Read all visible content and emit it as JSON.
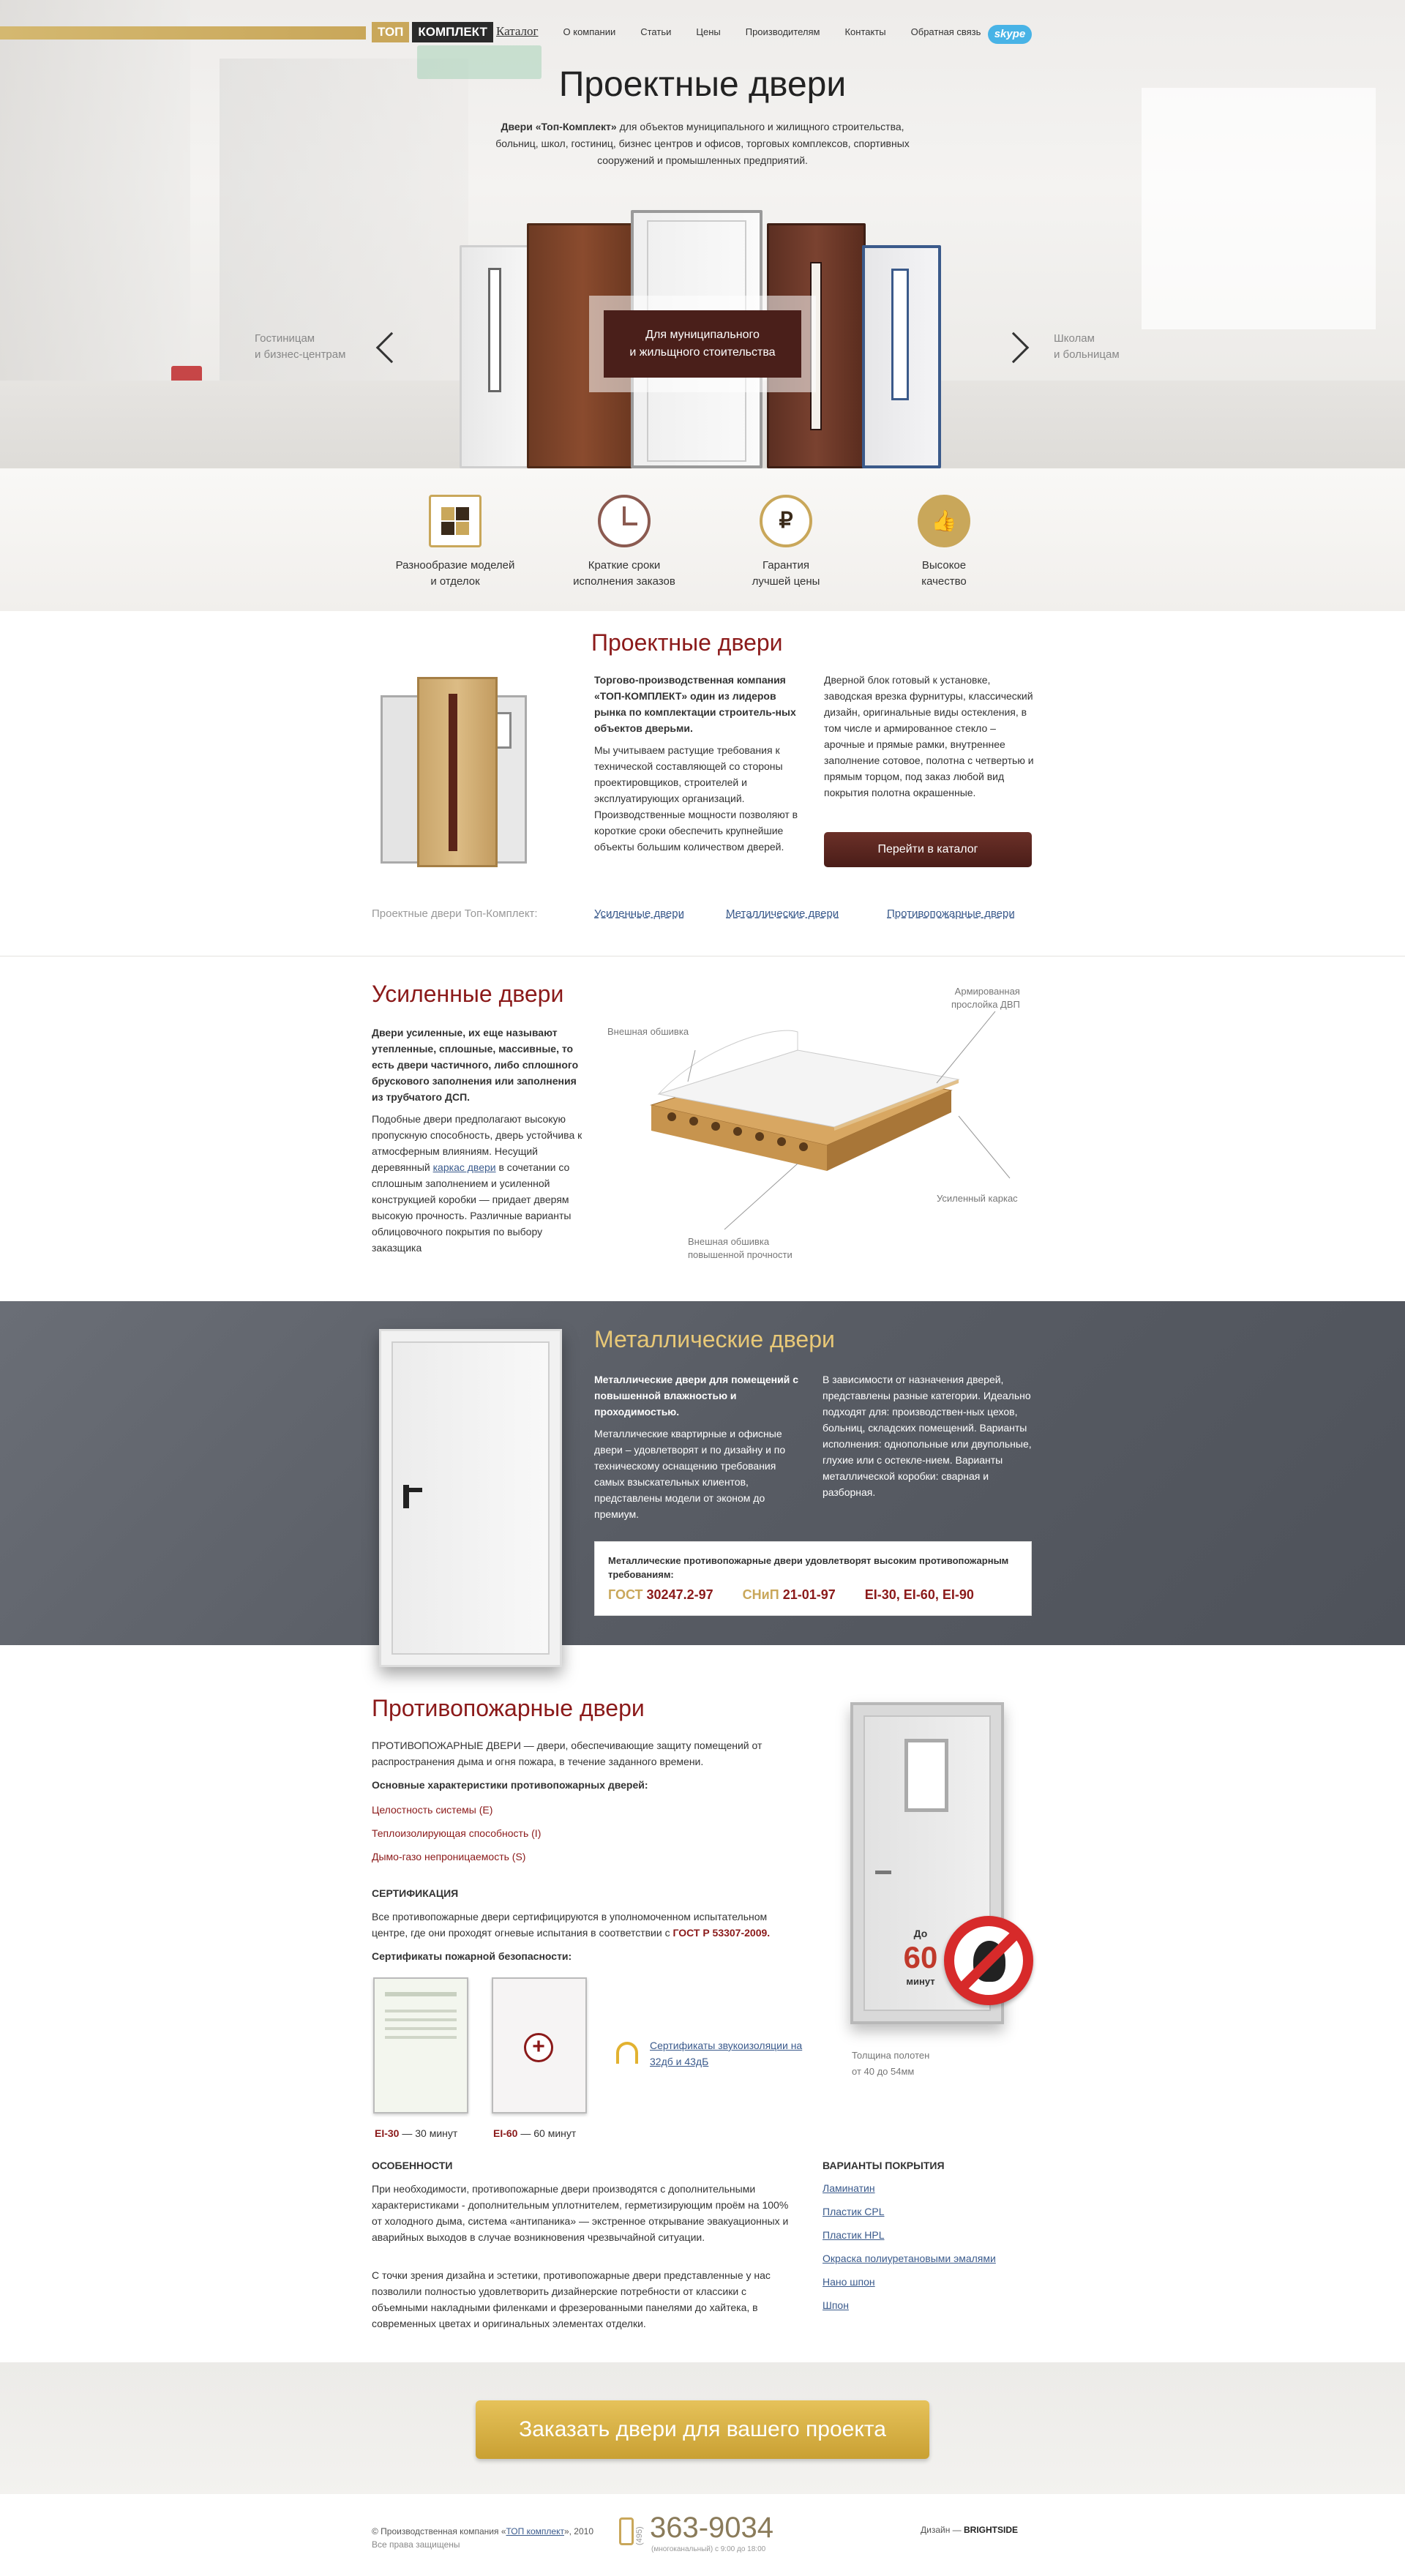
{
  "header": {
    "logo_top": "ТОП",
    "logo_bottom": "КОМПЛЕКТ",
    "nav": [
      "Каталог",
      "О компании",
      "Статьи",
      "Цены",
      "Производителям",
      "Контакты",
      "Обратная связь"
    ],
    "skype": "skype"
  },
  "hero": {
    "title": "Проектные двери",
    "lead_bold": "Двери «Топ-Комплект»",
    "lead_rest": " для объектов муниципального и жилищного строительства, больниц, школ, гостиниц, бизнес центров и офисов, торговых комплексов, спортивных сооружений и промышленных предприятий.",
    "badge_line1": "Для муниципального",
    "badge_line2": "и жильщного стоительства",
    "left_line1": "Гостиницам",
    "left_line2": "и бизнес-центрам",
    "right_line1": "Школам",
    "right_line2": "и больницам"
  },
  "features": [
    {
      "line1": "Разнообразие моделей",
      "line2": "и отделок",
      "icon": "grid-icon"
    },
    {
      "line1": "Краткие сроки",
      "line2": "исполнения заказов",
      "icon": "clock-icon"
    },
    {
      "line1": "Гарантия",
      "line2": "лучшей цены",
      "icon": "ruble-icon"
    },
    {
      "line1": "Высокое",
      "line2": "качество",
      "icon": "thumbs-up-icon"
    }
  ],
  "project": {
    "title": "Проектные двери",
    "col1_bold": "Торгово-производственная компания «ТОП-КОМПЛЕКТ» один из лидеров рынка по комплектации строитель-ных объектов дверьми.",
    "col1_text": "Мы учитываем растущие требования к технической составляющей со стороны проектировщиков, строителей и эксплуатирующих организаций. Производственные мощности позволяют в короткие сроки обеспечить крупнейшие объекты большим количеством дверей.",
    "col2_text": "Дверной блок готовый к установке, заводская врезка фурнитуры, классический дизайн, оригинальные виды остекления, в том числе и армированное стекло – арочные и прямые рамки, внутреннее заполнение сотовое, полотна с четвертью и прямым торцом, под заказ любой вид покрытия полотна окрашенные.",
    "button": "Перейти в каталог",
    "links_label": "Проектные двери Топ-Комплект:",
    "links": [
      "Усиленные двери",
      "Металлические двери",
      "Противопожарные двери"
    ]
  },
  "reinforced": {
    "title": "Усиленные двери",
    "bold": "Двери усиленные, их еще называют утепленные, сплошные, массивные, то есть двери частичного, либо сплошного брускового заполнения или заполнения из трубчатого ДСП.",
    "text1": "Подобные двери предполагают высокую пропускную способность, дверь устойчива к атмосферным влияниям. Несущий деревянный ",
    "link": "каркас двери",
    "text2": " в сочетании со сплошным заполнением и усиленной конструкцией коробки — придает дверям высокую прочность. Различные варианты облицовочного покрытия по выбору заказщика",
    "label_outer": "Внешная обшивка",
    "label_arm1": "Армированная",
    "label_arm2": "прослойка ДВП",
    "label_frame": "Усиленный каркас",
    "label_strong1": "Внешная обшивка",
    "label_strong2": "повышенной прочности"
  },
  "metal": {
    "title": "Металлические двери",
    "bold": "Металлические двери для помещений с повышенной влажностью и проходимостью.",
    "text": "Металлические квартирные и офисные двери – удовлетворят и по дизайну и по техническому оснащению требования самых взыскательных клиентов, представлены модели от эконом до премиум.",
    "col2": "В зависимости от назначения дверей, представлены разные категории. Идеально подходят для: производствен-ных цехов, больниц, складских помещений. Варианты исполнения: однопольные или двупольные, глухие или с остекле-нием. Варианты металлической коробки: сварная и разборная.",
    "cert_title": "Металлические противопожарные двери удовлетворят высоким противопожарным требованиям:",
    "gost_label": "ГОСТ",
    "gost_value": "30247.2-97",
    "snip_label": "СНиП",
    "snip_value": "21-01-97",
    "ei": "EI-30, EI-60, EI-90"
  },
  "fire": {
    "title": "Противопожарные двери",
    "intro": "ПРОТИВОПОЖАРНЫЕ ДВЕРИ — двери, обеспечивающие защиту помещений от распространения дыма и огня пожара, в течение заданного времени.",
    "chars_title": "Основные характеристики противопожарных дверей:",
    "chars": [
      "Целостность системы (E)",
      "Теплоизолирующая способность (I)",
      "Дымо-газо непроницаемость (S)"
    ],
    "cert_title": "СЕРТИФИКАЦИЯ",
    "cert_text1": "Все противопожарные двери сертифицируются в уполномоченном испытательном центре, где они проходят огневые испытания в соответствии с ",
    "cert_gost": "ГОСТ Р 53307-2009.",
    "safety_title": "Сертификаты пожарной безопасности:",
    "cert1_code": "EI-30",
    "cert1_rest": " — 30 минут",
    "cert2_code": "EI-60",
    "cert2_rest": " — 60 минут",
    "sound_link": "Сертификаты звукоизоляции на 32дб и 43дБ",
    "timer_do": "До",
    "timer_num": "60",
    "timer_unit": "минут",
    "thickness1": "Толщина полотен",
    "thickness2": "от 40 до 54мм",
    "features_title": "ОСОБЕННОСТИ",
    "features_p1": "При необходимости, противопожарные двери производятся с дополнительными характеристиками - дополнительным уплотнителем, герметизирующим проём на 100% от холодного дыма, система «антипаника» — экстренное открывание эвакуационных и аварийных выходов в случае возникновения чрезвычайной ситуации.",
    "features_p2": "С точки зрения дизайна и эстетики,  противопожарные двери  представленные у нас позволили полностью удовлетворить дизайнерские потребности от классики с объемными накладными филенками и фрезерованными панелями до хайтека, в современных цветах и оригинальных  элементах отделки.",
    "coat_title": "ВАРИАНТЫ ПОКРЫТИЯ",
    "coats": [
      "Ламинатин",
      "Пластик CPL",
      "Пластик HPL",
      "Окраска полиуретановыми эмалями",
      "Нано шпон",
      "Шпон"
    ]
  },
  "cta": {
    "label": "Заказать двери для вашего проекта"
  },
  "footer": {
    "copy1": "© Производственная компания «",
    "copy_link": "ТОП комплект",
    "copy2": "», 2010",
    "rights": "Все права защищены",
    "phone_code": "(495)",
    "phone": "363-9034",
    "hours": "(многоканальный) с 9:00 до 18:00",
    "design_label": "Дизайн —",
    "design_brand": "BRIGHTSIDE"
  },
  "colors": {
    "accent": "#8b1a1a",
    "gold": "#c9a75a",
    "metal_bg": "#5a5e66",
    "button": "#4a1d18"
  }
}
